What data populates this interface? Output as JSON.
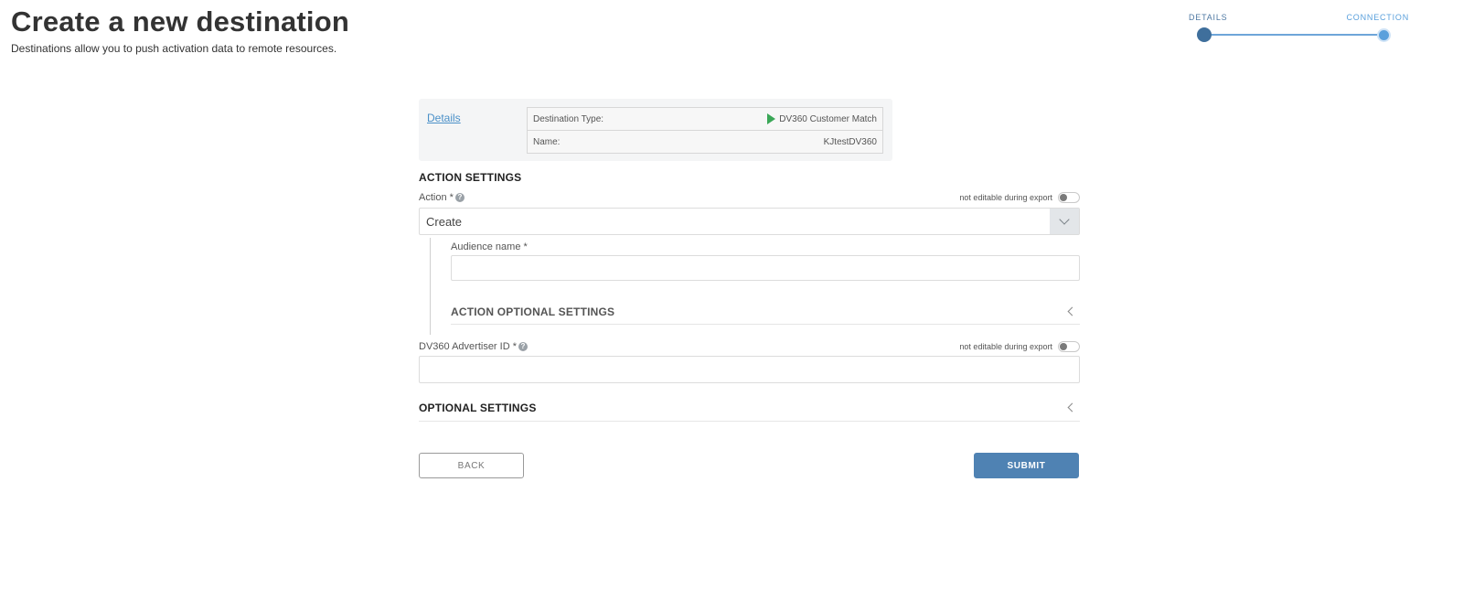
{
  "header": {
    "title": "Create a new destination",
    "subtitle": "Destinations allow you to push activation data to remote resources."
  },
  "stepper": {
    "steps": [
      {
        "label": "DETAILS"
      },
      {
        "label": "CONNECTION"
      }
    ]
  },
  "details_card": {
    "link_label": "Details",
    "rows": [
      {
        "label": "Destination Type:",
        "value": "DV360 Customer Match",
        "icon": "play-icon"
      },
      {
        "label": "Name:",
        "value": "KJtestDV360"
      }
    ]
  },
  "action_settings": {
    "title": "ACTION SETTINGS",
    "action_field": {
      "label": "Action *",
      "toggle_label": "not editable during export",
      "selected_value": "Create"
    },
    "audience_name": {
      "label": "Audience name *",
      "value": ""
    },
    "action_optional_settings_title": "ACTION OPTIONAL SETTINGS"
  },
  "advertiser_id": {
    "label": "DV360 Advertiser ID *",
    "toggle_label": "not editable during export",
    "value": ""
  },
  "optional_settings_title": "OPTIONAL SETTINGS",
  "buttons": {
    "back": "BACK",
    "submit": "SUBMIT"
  },
  "colors": {
    "primary": "#4f82b3",
    "link": "#4a90c8",
    "step_active": "#3f6f9c",
    "step_next": "#5aa0dc",
    "destination_icon": "#3aa757"
  }
}
